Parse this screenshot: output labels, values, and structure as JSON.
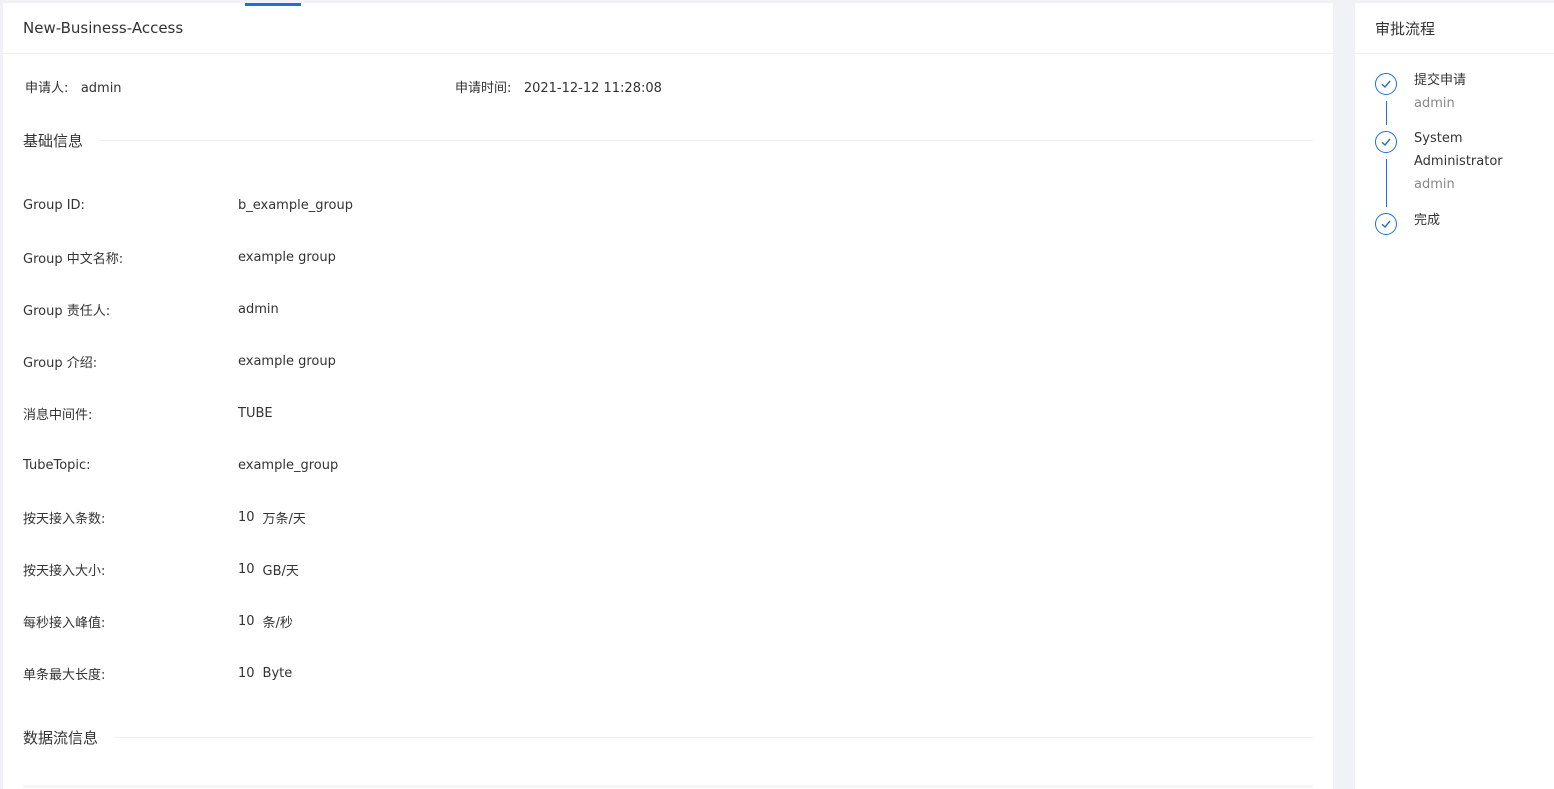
{
  "header": {
    "title": "New-Business-Access"
  },
  "meta": {
    "applicant_label": "申请人:",
    "applicant_value": "admin",
    "time_label": "申请时间:",
    "time_value": "2021-12-12 11:28:08"
  },
  "sections": {
    "basic_info": "基础信息",
    "stream_info": "数据流信息"
  },
  "fields": [
    {
      "label": "Group ID:",
      "value": "b_example_group",
      "unit": ""
    },
    {
      "label": "Group 中文名称:",
      "value": "example group",
      "unit": ""
    },
    {
      "label": "Group 责任人:",
      "value": "admin",
      "unit": ""
    },
    {
      "label": "Group 介绍:",
      "value": "example group",
      "unit": ""
    },
    {
      "label": "消息中间件:",
      "value": "TUBE",
      "unit": ""
    },
    {
      "label": "TubeTopic:",
      "value": "example_group",
      "unit": ""
    },
    {
      "label": "按天接入条数:",
      "value": "10",
      "unit": "万条/天"
    },
    {
      "label": "按天接入大小:",
      "value": "10",
      "unit": "GB/天"
    },
    {
      "label": "每秒接入峰值:",
      "value": "10",
      "unit": "条/秒"
    },
    {
      "label": "单条最大长度:",
      "value": "10",
      "unit": "Byte"
    }
  ],
  "approval": {
    "title": "审批流程",
    "steps": [
      {
        "name": "提交申请",
        "user": "admin"
      },
      {
        "name": "System",
        "name2": "Administrator",
        "user": "admin"
      },
      {
        "name": "完成"
      }
    ]
  },
  "colors": {
    "accent": "#1f6fd6",
    "background": "#f0f2f5"
  }
}
